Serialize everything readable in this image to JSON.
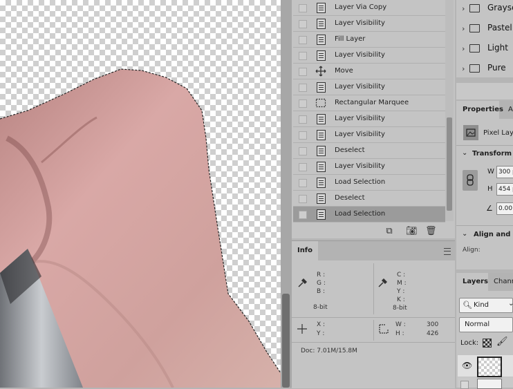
{
  "history": {
    "items": [
      {
        "label": "Layer Via Copy",
        "icon": "document-icon"
      },
      {
        "label": "Layer Visibility",
        "icon": "document-icon"
      },
      {
        "label": "Fill Layer",
        "icon": "document-icon"
      },
      {
        "label": "Layer Visibility",
        "icon": "document-icon"
      },
      {
        "label": "Move",
        "icon": "move-icon"
      },
      {
        "label": "Layer Visibility",
        "icon": "document-icon"
      },
      {
        "label": "Rectangular Marquee",
        "icon": "marquee-icon"
      },
      {
        "label": "Layer Visibility",
        "icon": "document-icon"
      },
      {
        "label": "Layer Visibility",
        "icon": "document-icon"
      },
      {
        "label": "Deselect",
        "icon": "document-icon"
      },
      {
        "label": "Layer Visibility",
        "icon": "document-icon"
      },
      {
        "label": "Load Selection",
        "icon": "document-icon"
      },
      {
        "label": "Deselect",
        "icon": "document-icon"
      },
      {
        "label": "Load Selection",
        "icon": "document-icon",
        "selected": true
      }
    ]
  },
  "info": {
    "tab": "Info",
    "rgb": {
      "r": "R :",
      "g": "G :",
      "b": "B :",
      "depth": "8-bit"
    },
    "cmyk": {
      "c": "C :",
      "m": "M :",
      "y": "Y :",
      "k": "K :",
      "depth": "8-bit"
    },
    "xy": {
      "x": "X :",
      "y": "Y :"
    },
    "wh": {
      "w": "W :",
      "w_val": "300",
      "h": "H :",
      "h_val": "426"
    },
    "doc": "Doc: 7.01M/15.8M"
  },
  "swatch_folders": [
    "Graysc",
    "Pastel",
    "Light",
    "Pure"
  ],
  "properties": {
    "tab": "Properties",
    "tab2": "A",
    "layer_type": "Pixel Laye",
    "transform": "Transform",
    "w_label": "W",
    "w_val": "300 p",
    "h_label": "H",
    "h_val": "454 p",
    "angle_val": "0.00",
    "align": "Align and D",
    "align_label": "Align:"
  },
  "layers": {
    "tab": "Layers",
    "tab2": "Chann",
    "kind": "Kind",
    "blend": "Normal",
    "lock": "Lock:"
  }
}
